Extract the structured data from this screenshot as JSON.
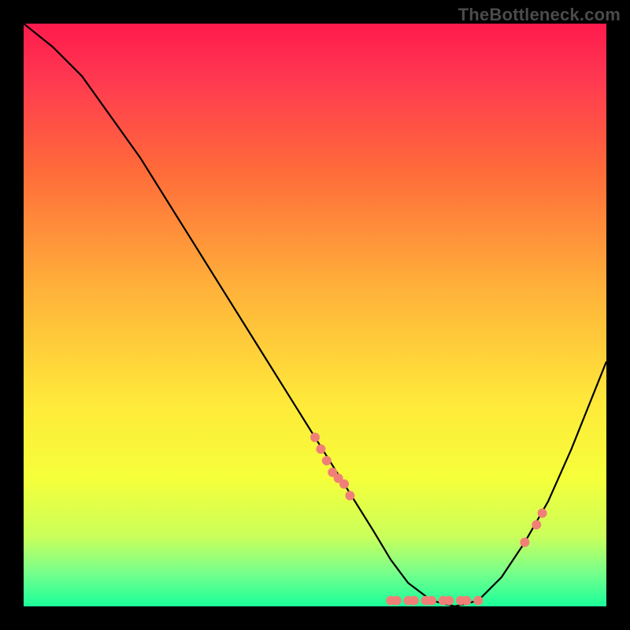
{
  "watermark": "TheBottleneck.com",
  "chart_data": {
    "type": "line",
    "title": "",
    "xlabel": "",
    "ylabel": "",
    "xlim": [
      0,
      100
    ],
    "ylim": [
      0,
      100
    ],
    "series": [
      {
        "name": "bottleneck-curve",
        "x": [
          0,
          5,
          10,
          15,
          20,
          25,
          30,
          35,
          40,
          45,
          50,
          55,
          60,
          63,
          66,
          70,
          74,
          78,
          82,
          86,
          90,
          94,
          98,
          100
        ],
        "y": [
          100,
          96,
          91,
          84,
          77,
          69,
          61,
          53,
          45,
          37,
          29,
          21,
          13,
          8,
          4,
          1,
          0,
          1,
          5,
          11,
          18,
          27,
          37,
          42
        ]
      }
    ],
    "points": [
      {
        "x": 50,
        "y": 29
      },
      {
        "x": 51,
        "y": 27
      },
      {
        "x": 52,
        "y": 25
      },
      {
        "x": 53,
        "y": 23
      },
      {
        "x": 54,
        "y": 22
      },
      {
        "x": 55,
        "y": 21
      },
      {
        "x": 56,
        "y": 19
      },
      {
        "x": 63,
        "y": 1
      },
      {
        "x": 64,
        "y": 1
      },
      {
        "x": 66,
        "y": 1
      },
      {
        "x": 67,
        "y": 1
      },
      {
        "x": 69,
        "y": 1
      },
      {
        "x": 70,
        "y": 1
      },
      {
        "x": 72,
        "y": 1
      },
      {
        "x": 73,
        "y": 1
      },
      {
        "x": 75,
        "y": 1
      },
      {
        "x": 76,
        "y": 1
      },
      {
        "x": 78,
        "y": 1
      },
      {
        "x": 86,
        "y": 11
      },
      {
        "x": 88,
        "y": 14
      },
      {
        "x": 89,
        "y": 16
      }
    ],
    "gradient_stops": [
      {
        "offset": 0,
        "color": "#ff1a4d"
      },
      {
        "offset": 25,
        "color": "#ff6a3a"
      },
      {
        "offset": 65,
        "color": "#ffe93a"
      },
      {
        "offset": 100,
        "color": "#1aff9a"
      }
    ]
  }
}
